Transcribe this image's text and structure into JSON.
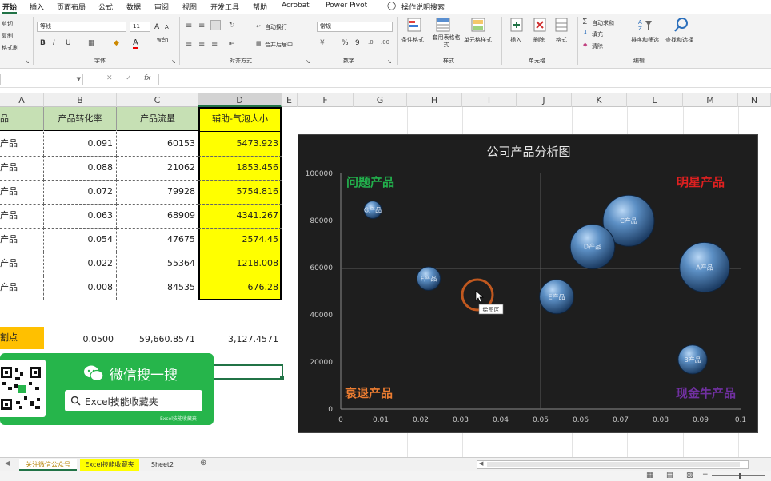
{
  "ribbon_tabs": [
    "开始",
    "插入",
    "页面布局",
    "公式",
    "数据",
    "审阅",
    "视图",
    "开发工具",
    "帮助",
    "Acrobat",
    "Power Pivot",
    "操作说明搜索"
  ],
  "clipboard": {
    "cut": "剪切",
    "copy": "复制",
    "painter": "格式刷"
  },
  "font": {
    "name": "等线",
    "size": "11",
    "bold": "B",
    "italic": "I",
    "underline": "U",
    "group": "字体",
    "grow": "A",
    "shrink": "A",
    "font_color": "A",
    "wen": "wén"
  },
  "alignment": {
    "wrap": "自动换行",
    "merge": "合并后居中",
    "group": "对齐方式"
  },
  "number": {
    "format": "常规",
    "percent": "%",
    "comma": "9",
    "group": "数字"
  },
  "styles": {
    "conditional": "条件格式",
    "table": "套用表格格式",
    "cell": "单元格样式",
    "group": "样式"
  },
  "cells": {
    "insert": "插入",
    "delete": "删除",
    "format": "格式",
    "group": "单元格"
  },
  "editing": {
    "autosum": "自动求和",
    "fill": "填充",
    "clear": "清除",
    "sort": "排序和筛选",
    "find": "查找和选择",
    "group": "编辑"
  },
  "formula_bar": {
    "name_box": "",
    "fx": "fx",
    "formula": ""
  },
  "columns": [
    "A",
    "B",
    "C",
    "D",
    "E",
    "F",
    "G",
    "H",
    "I",
    "J",
    "K",
    "L",
    "M",
    "N"
  ],
  "table": {
    "headers": [
      "品",
      "产品转化率",
      "产品流量",
      "辅助-气泡大小"
    ],
    "rows": [
      [
        "产品",
        "0.091",
        "60153",
        "5473.923"
      ],
      [
        "产品",
        "0.088",
        "21062",
        "1853.456"
      ],
      [
        "产品",
        "0.072",
        "79928",
        "5754.816"
      ],
      [
        "产品",
        "0.063",
        "68909",
        "4341.267"
      ],
      [
        "产品",
        "0.054",
        "47675",
        "2574.45"
      ],
      [
        "产品",
        "0.022",
        "55364",
        "1218.008"
      ],
      [
        "产品",
        "0.008",
        "84535",
        "676.28"
      ]
    ],
    "split_label": "割点",
    "split_values": [
      "0.0500",
      "59,660.8571",
      "3,127.4571"
    ]
  },
  "wechat": {
    "title": "微信搜一搜",
    "search": "Excel技能收藏夹",
    "small_caption": "Excel技能收藏夹"
  },
  "chart_data": {
    "type": "bubble",
    "title": "公司产品分析图",
    "xlim": [
      0,
      0.1
    ],
    "ylim": [
      0,
      100000
    ],
    "x_ticks": [
      "0",
      "0.01",
      "0.02",
      "0.03",
      "0.04",
      "0.05",
      "0.06",
      "0.07",
      "0.08",
      "0.09",
      "0.1"
    ],
    "y_ticks": [
      "0",
      "20000",
      "40000",
      "60000",
      "80000",
      "100000"
    ],
    "divider": {
      "x": 0.05,
      "y": 59660.8571
    },
    "quadrants": {
      "top_left": "问题产品",
      "top_right": "明星产品",
      "bottom_left": "衰退产品",
      "bottom_right": "现金牛产品"
    },
    "points": [
      {
        "label": "A产品",
        "x": 0.091,
        "y": 60153,
        "size": 5473.923
      },
      {
        "label": "B产品",
        "x": 0.088,
        "y": 21062,
        "size": 1853.456
      },
      {
        "label": "C产品",
        "x": 0.072,
        "y": 79928,
        "size": 5754.816
      },
      {
        "label": "D产品",
        "x": 0.063,
        "y": 68909,
        "size": 4341.267
      },
      {
        "label": "E产品",
        "x": 0.054,
        "y": 47675,
        "size": 2574.45
      },
      {
        "label": "F产品",
        "x": 0.022,
        "y": 55364,
        "size": 1218.008
      },
      {
        "label": "G产品",
        "x": 0.008,
        "y": 84535,
        "size": 676.28
      }
    ],
    "tooltip": "绘图区"
  },
  "sheets": [
    "关注微信公众号",
    "Excel技能收藏夹",
    "Sheet2"
  ],
  "colors": {
    "header_green": "#c6e0b4",
    "highlight_yellow": "#ffff00",
    "split_orange": "#ffc000",
    "chart_bg": "#1e1e1e",
    "qr_green": "#26b54b",
    "star_red": "#e02020",
    "question_green": "#22b04c",
    "decline_orange": "#ed7d31",
    "cash_purple": "#7030a0"
  }
}
